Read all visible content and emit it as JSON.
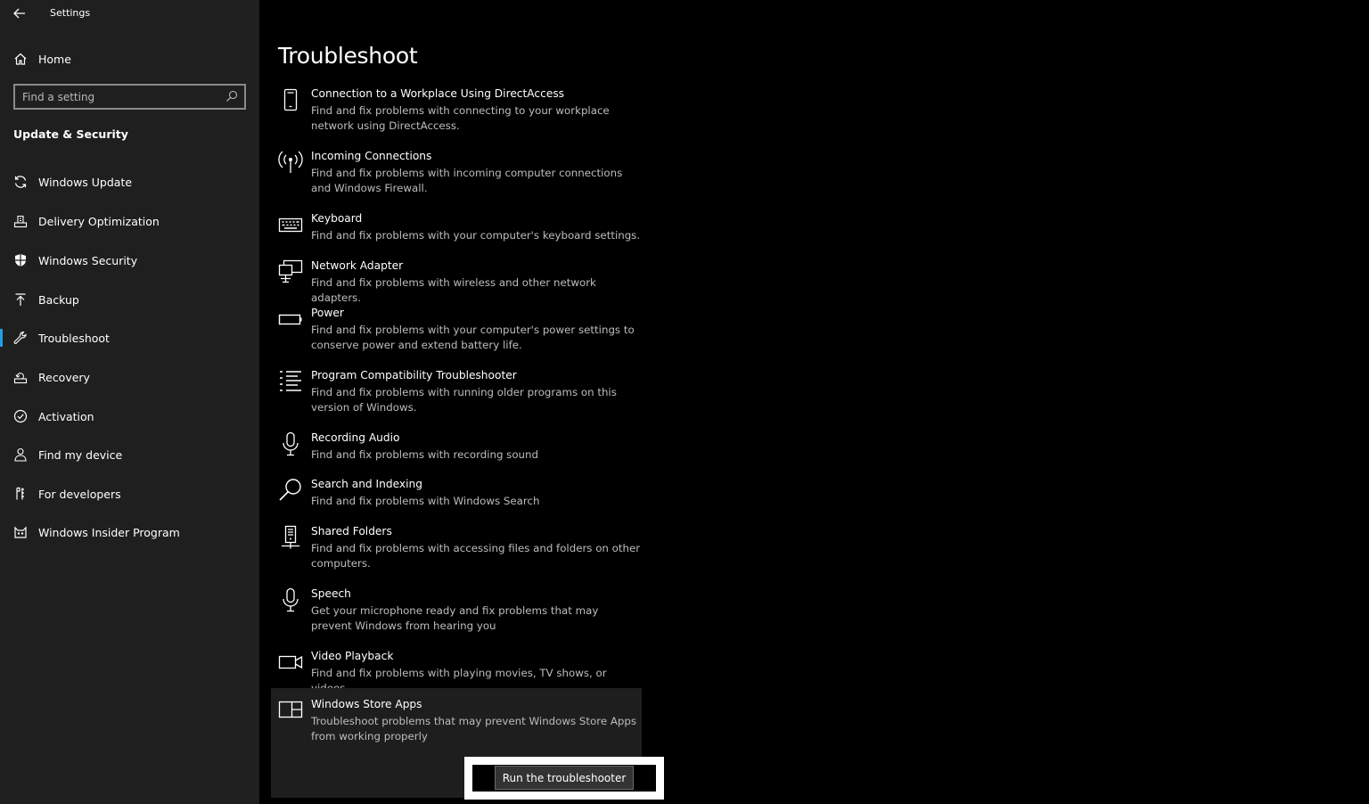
{
  "window": {
    "title": "Settings"
  },
  "sidebar": {
    "home_label": "Home",
    "search_placeholder": "Find a setting",
    "section_heading": "Update & Security",
    "items": [
      {
        "label": "Windows Update",
        "icon": "refresh-icon"
      },
      {
        "label": "Delivery Optimization",
        "icon": "delivery-icon"
      },
      {
        "label": "Windows Security",
        "icon": "shield-icon"
      },
      {
        "label": "Backup",
        "icon": "backup-arrow-icon"
      },
      {
        "label": "Troubleshoot",
        "icon": "wrench-icon",
        "selected": true
      },
      {
        "label": "Recovery",
        "icon": "recovery-icon"
      },
      {
        "label": "Activation",
        "icon": "check-circle-icon"
      },
      {
        "label": "Find my device",
        "icon": "person-location-icon"
      },
      {
        "label": "For developers",
        "icon": "developer-tools-icon"
      },
      {
        "label": "Windows Insider Program",
        "icon": "insider-cat-icon"
      }
    ],
    "accent_color": "#1fa0e0"
  },
  "main": {
    "title": "Troubleshoot",
    "items": [
      {
        "name": "Connection to a Workplace Using DirectAccess",
        "desc": "Find and fix problems with connecting to your workplace network using DirectAccess.",
        "icon": "phone-device-icon"
      },
      {
        "name": "Incoming Connections",
        "desc": "Find and fix problems with incoming computer connections and Windows Firewall.",
        "icon": "antenna-icon"
      },
      {
        "name": "Keyboard",
        "desc": "Find and fix problems with your computer's keyboard settings.",
        "icon": "keyboard-icon"
      },
      {
        "name": "Network Adapter",
        "desc": "Find and fix problems with wireless and other network adapters.",
        "icon": "network-adapter-icon"
      },
      {
        "name": "Power",
        "desc": "Find and fix problems with your computer's power settings to conserve power and extend battery life.",
        "icon": "battery-icon"
      },
      {
        "name": "Program Compatibility Troubleshooter",
        "desc": "Find and fix problems with running older programs on this version of Windows.",
        "icon": "list-icon"
      },
      {
        "name": "Recording Audio",
        "desc": "Find and fix problems with recording sound",
        "icon": "microphone-icon"
      },
      {
        "name": "Search and Indexing",
        "desc": "Find and fix problems with Windows Search",
        "icon": "search-icon"
      },
      {
        "name": "Shared Folders",
        "desc": "Find and fix problems with accessing files and folders on other computers.",
        "icon": "shared-folder-icon"
      },
      {
        "name": "Speech",
        "desc": "Get your microphone ready and fix problems that may prevent Windows from hearing you",
        "icon": "microphone-icon"
      },
      {
        "name": "Video Playback",
        "desc": "Find and fix problems with playing movies, TV shows, or videos",
        "icon": "video-camera-icon"
      }
    ],
    "expanded_item": {
      "name": "Windows Store Apps",
      "desc": "Troubleshoot problems that may prevent Windows Store Apps from working properly",
      "icon": "store-apps-icon",
      "button_label": "Run the troubleshooter"
    }
  }
}
